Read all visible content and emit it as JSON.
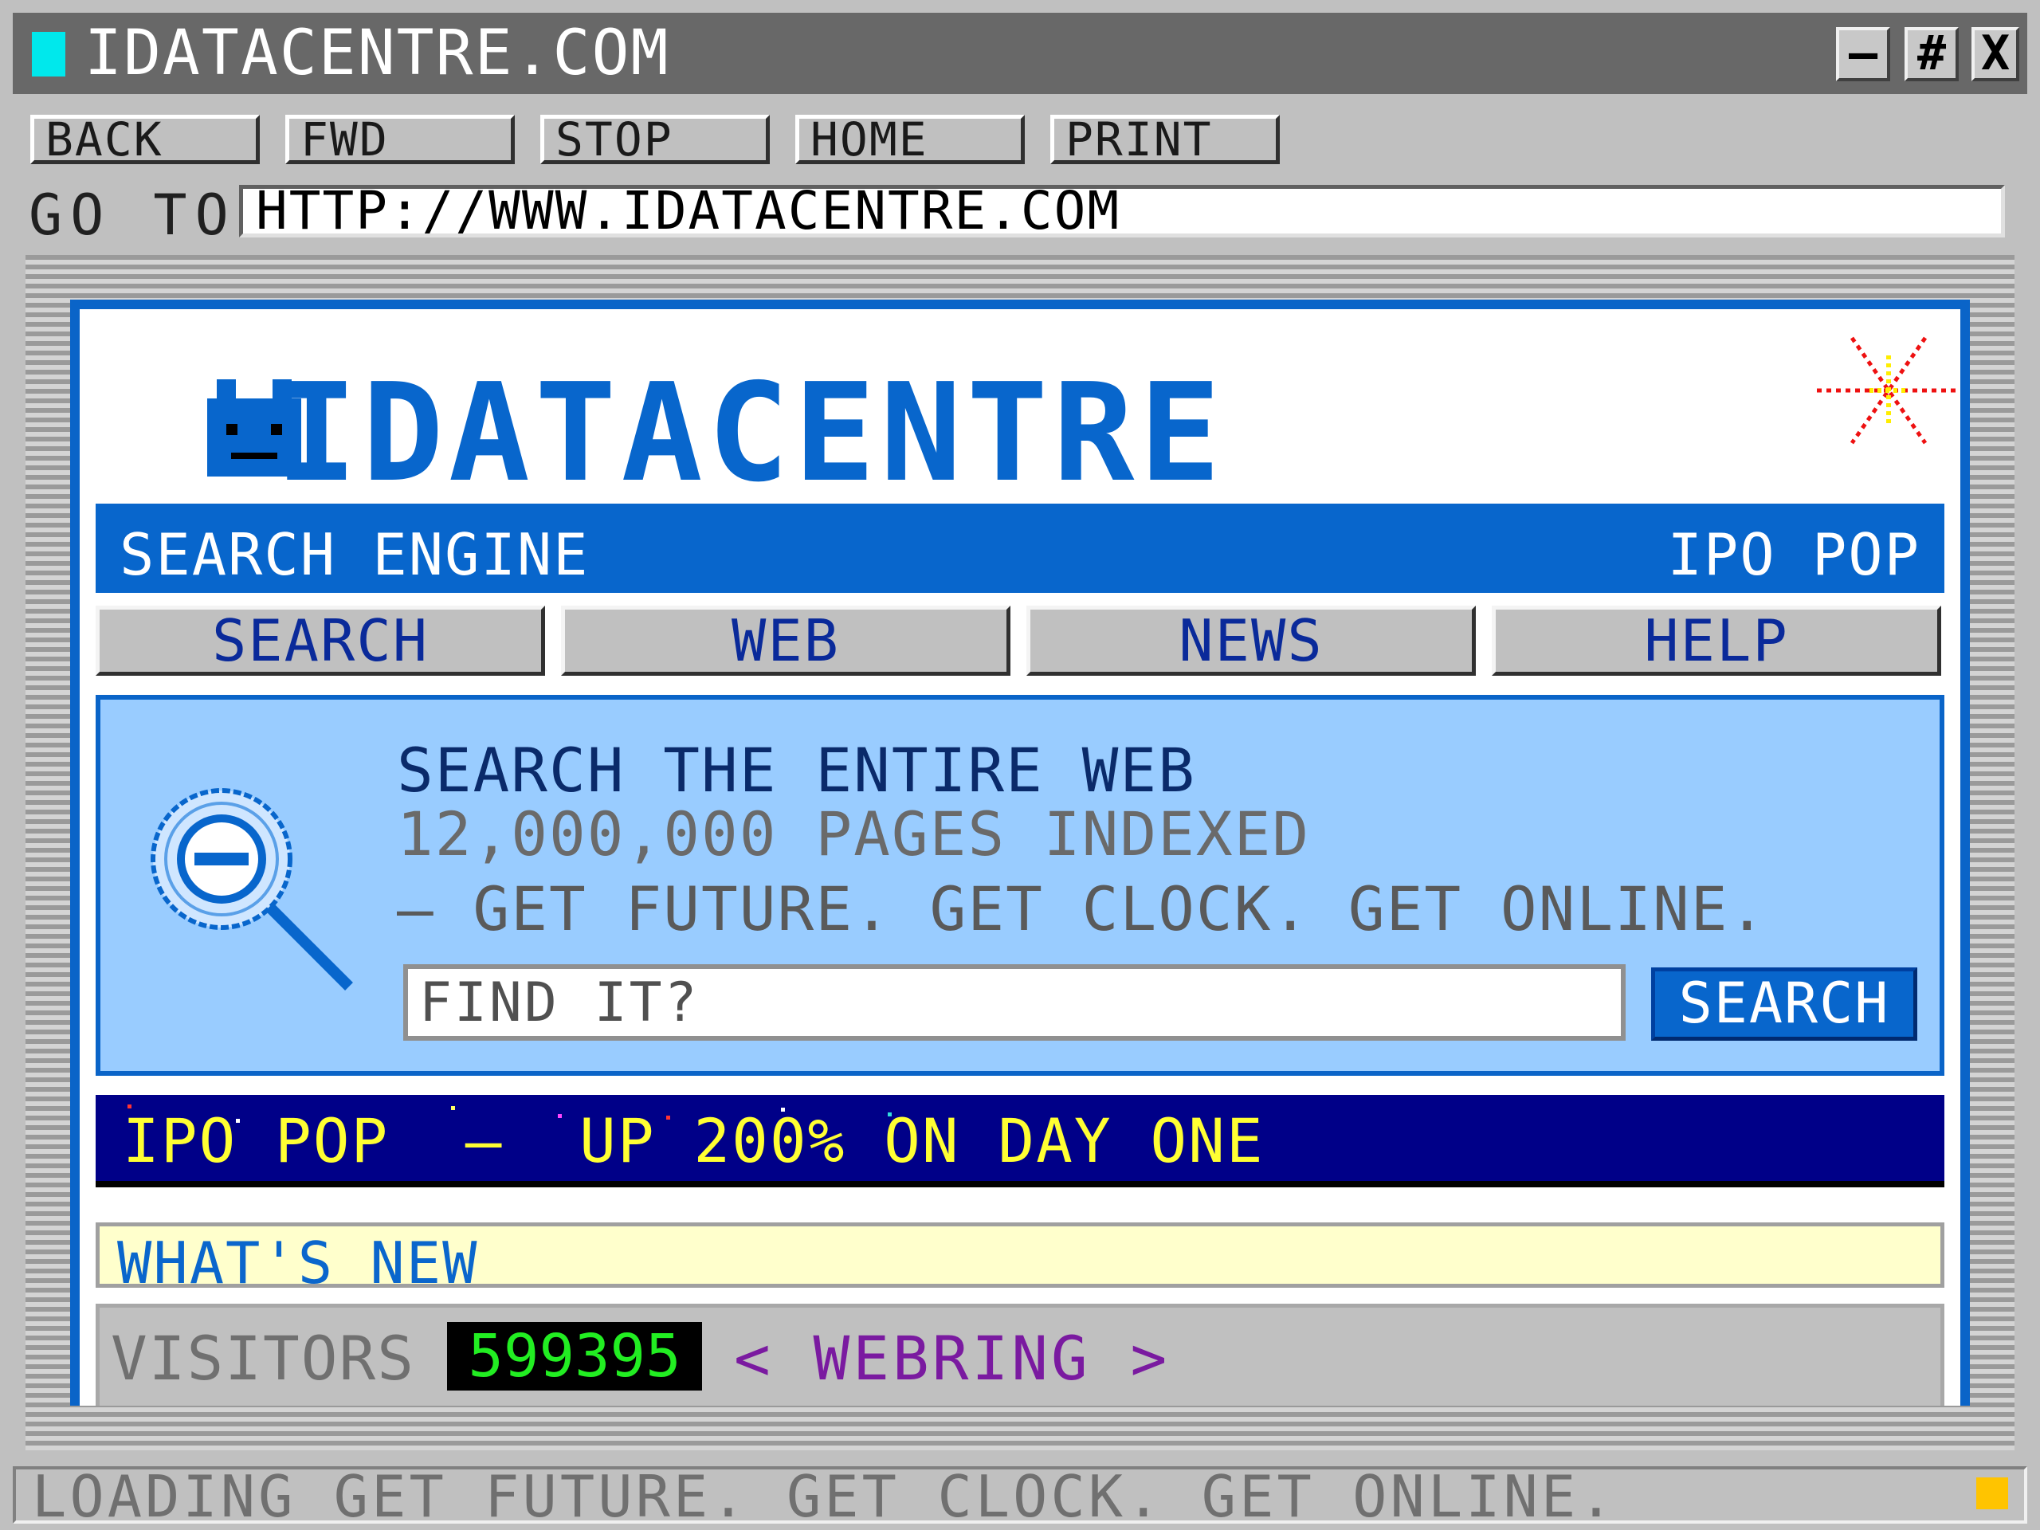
{
  "window": {
    "title": "IDATACENTRE.COM",
    "controls": {
      "minimize": "–",
      "maximize": "#",
      "close": "X"
    }
  },
  "toolbar": {
    "back": "BACK",
    "forward": "FWD",
    "stop": "STOP",
    "home": "HOME",
    "print": "PRINT"
  },
  "address": {
    "label": "GO TO",
    "url": "HTTP://WWW.IDATACENTRE.COM"
  },
  "site": {
    "logo_text": "IDATACENTRE",
    "bar_left": "SEARCH ENGINE",
    "bar_right": "IPO POP",
    "tabs": [
      {
        "label": "SEARCH"
      },
      {
        "label": "WEB"
      },
      {
        "label": "NEWS"
      },
      {
        "label": "HELP"
      }
    ],
    "search_panel": {
      "title": "SEARCH THE ENTIRE WEB",
      "count": "12,000,000 PAGES INDEXED",
      "tagline": "– GET FUTURE. GET CLOCK. GET ONLINE.",
      "placeholder": "FIND IT?",
      "button": "SEARCH"
    },
    "ticker": "IPO POP  –  UP 200% ON DAY ONE",
    "whats_new": "WHAT'S NEW",
    "visitors_label": "VISITORS",
    "visitor_count": "599395",
    "webring": "< WEBRING >"
  },
  "status": {
    "text": "LOADING GET FUTURE. GET CLOCK. GET ONLINE."
  },
  "colors": {
    "brand_blue": "#0866cc",
    "title_bar": "#686868",
    "panel_blue": "#99ccff",
    "ticker_bg": "#000088",
    "ticker_text": "#ffff33",
    "counter_digits": "#22ee22",
    "webring": "#7a1aa0",
    "status_light": "#ffc400"
  },
  "icons": {
    "title": "app-square-icon",
    "logo": "robot-face-icon",
    "sparkle": "sparkle-icon",
    "search": "magnifier-icon",
    "status": "loading-light-icon"
  }
}
